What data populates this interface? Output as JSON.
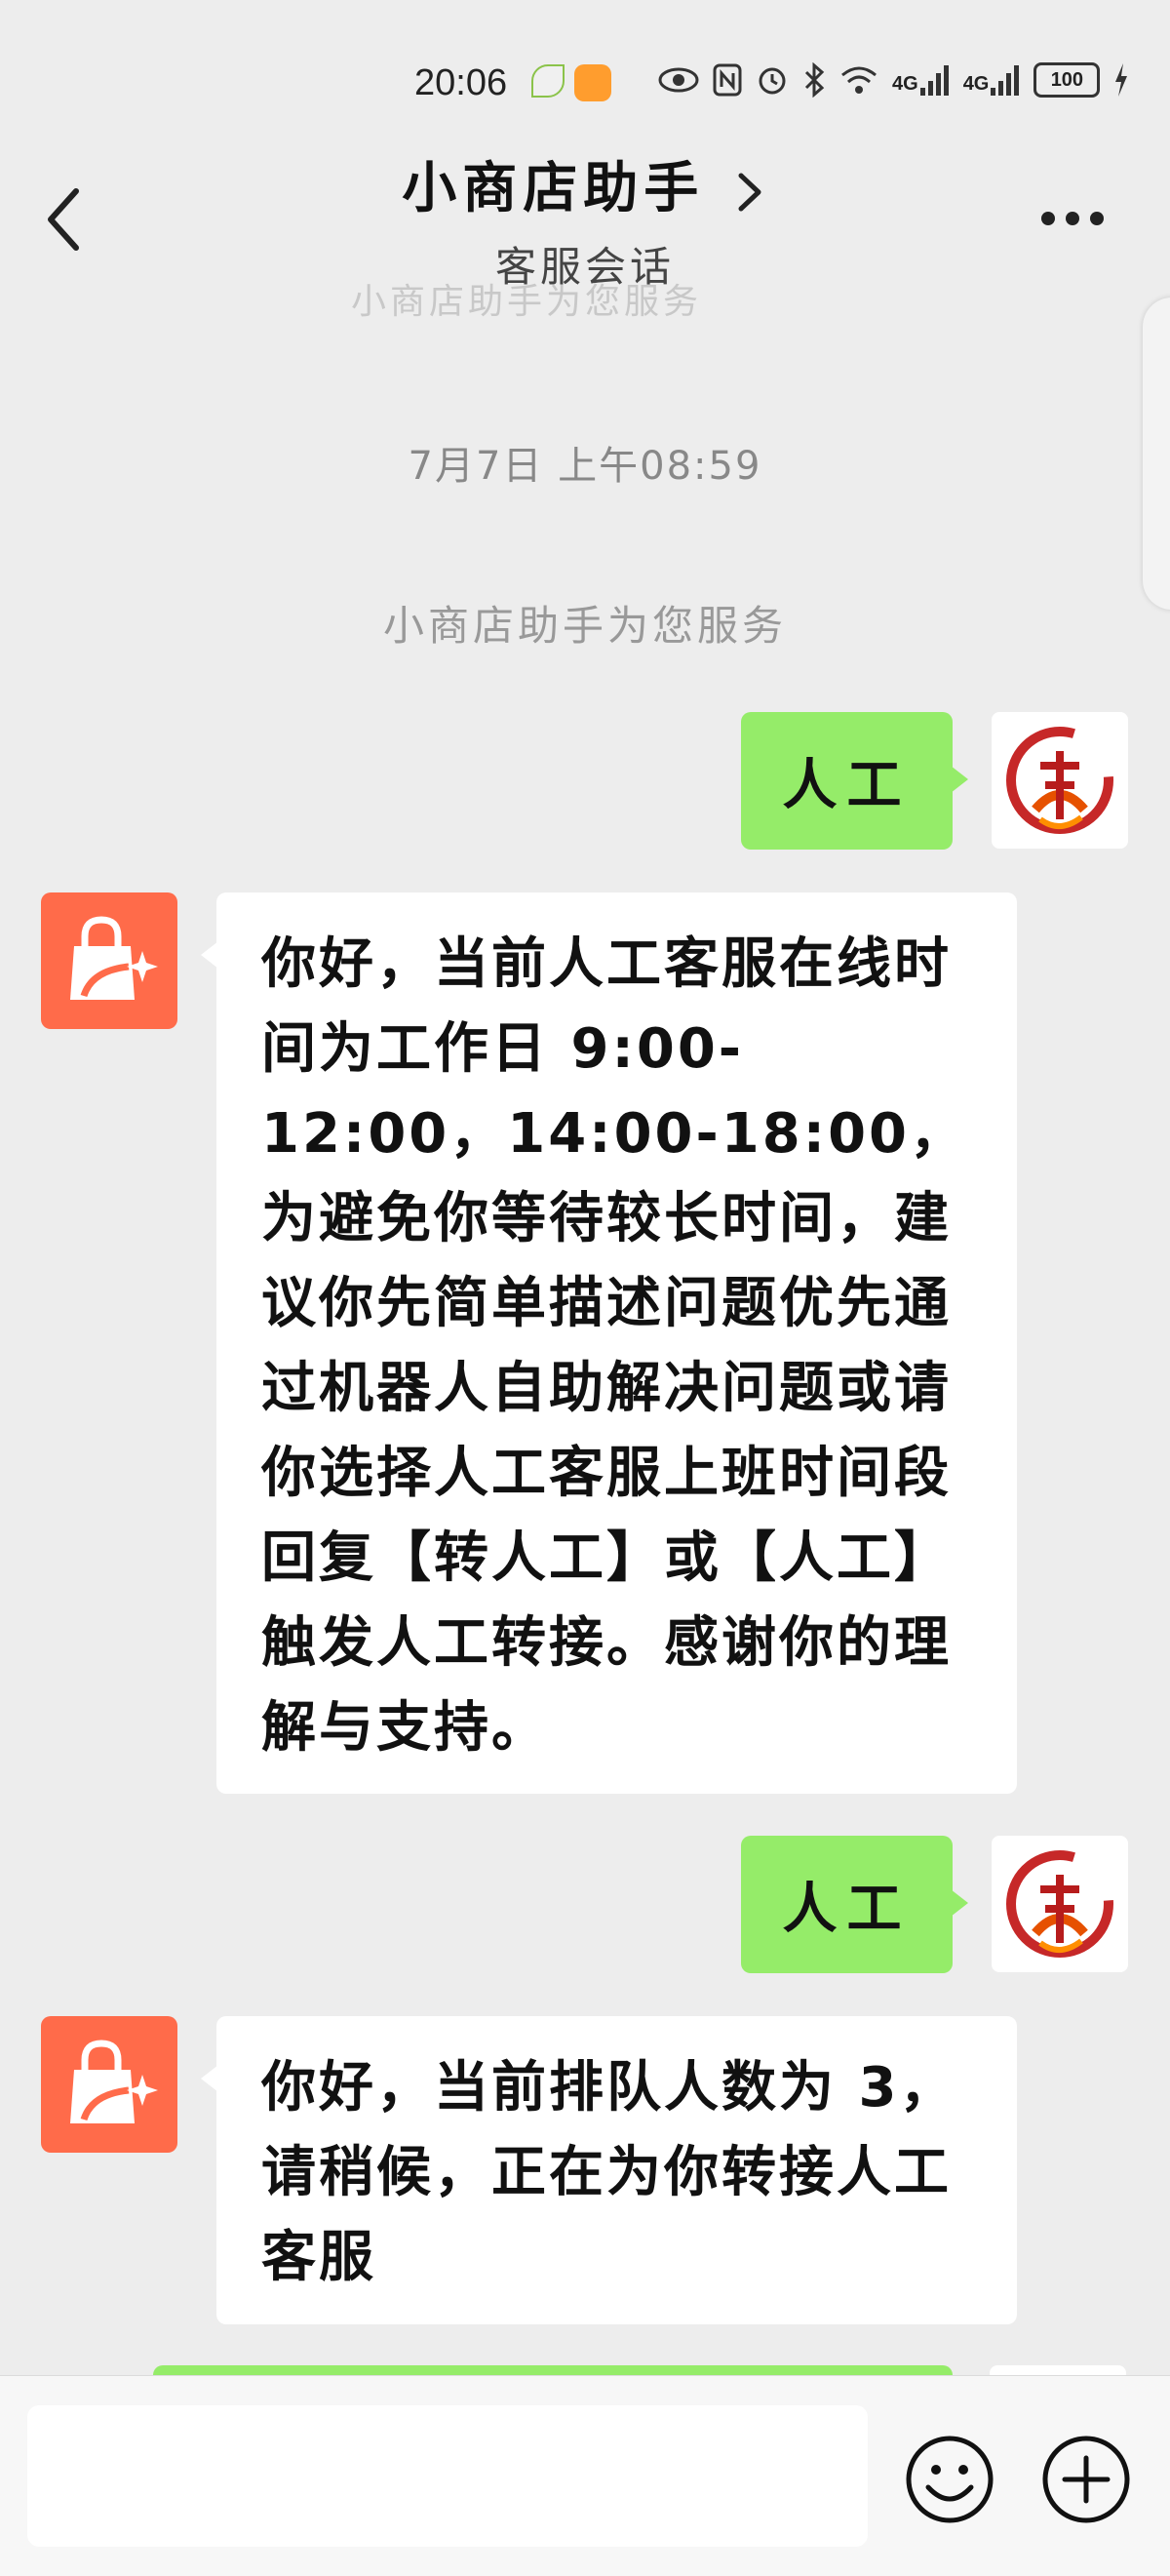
{
  "status_bar": {
    "time": "20:06",
    "network_1": "4G",
    "network_2": "4G",
    "battery": "100"
  },
  "header": {
    "title": "小商店助手",
    "subtitle": "客服会话",
    "faded_text": "小商店助手为您服务"
  },
  "chat": {
    "timestamp": "7月7日 上午08:59",
    "service_notice": "小商店助手为您服务",
    "messages": [
      {
        "from": "user",
        "text": "人工"
      },
      {
        "from": "shop",
        "text": "你好，当前人工客服在线时间为工作日 9:00-12:00，14:00-18:00，为避免你等待较长时间，建议你先简单描述问题优先通过机器人自助解决问题或请你选择人工客服上班时间段回复【转人工】或【人工】触发人工转接。感谢你的理解与支持。"
      },
      {
        "from": "user",
        "text": "人工"
      },
      {
        "from": "shop",
        "text": "你好，当前排队人数为 3，请稍候，正在为你转接人工客服"
      }
    ]
  },
  "input": {
    "value": "",
    "placeholder": ""
  },
  "colors": {
    "background": "#ededed",
    "outgoing_bubble": "#95ec69",
    "incoming_bubble": "#ffffff",
    "shop_avatar": "#ff6b4a"
  },
  "icons": {
    "back": "back-arrow-icon",
    "title_chevron": "chevron-right-icon",
    "more": "more-dots-icon",
    "emoji": "emoji-icon",
    "plus": "plus-icon",
    "shop_avatar": "shopping-bag-icon",
    "user_avatar": "calligraphy-logo-icon"
  }
}
